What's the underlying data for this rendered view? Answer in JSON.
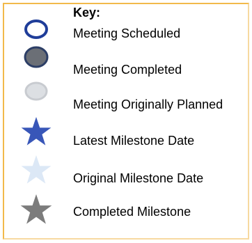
{
  "legend": {
    "title": "Key:",
    "items": [
      {
        "label": "Meeting Scheduled",
        "symbol": "open-ellipse-icon",
        "stroke": "#1f3d99",
        "fill": "#ffffff"
      },
      {
        "label": "Meeting Completed",
        "symbol": "filled-ellipse-icon",
        "stroke": "#2c3e66",
        "fill": "#6b6f76"
      },
      {
        "label": "Meeting Originally Planned",
        "symbol": "faded-ellipse-icon",
        "stroke": "#c8cbd0",
        "fill": "#dcdfe3"
      },
      {
        "label": "Latest Milestone Date",
        "symbol": "blue-star-icon",
        "fill": "#3856b8"
      },
      {
        "label": "Original Milestone Date",
        "symbol": "light-blue-star-icon",
        "fill": "#dce8f6"
      },
      {
        "label": "Completed Milestone",
        "symbol": "gray-star-icon",
        "fill": "#7c7c7c"
      }
    ],
    "border_color": "#f2b94a"
  }
}
